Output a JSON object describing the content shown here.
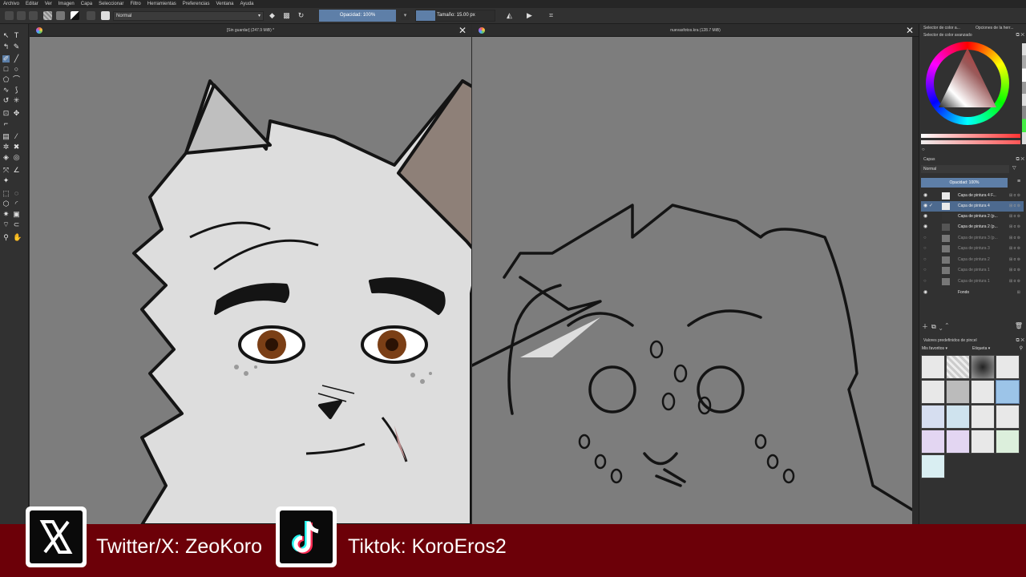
{
  "menu": [
    "Archivo",
    "Editar",
    "Ver",
    "Imagen",
    "Capa",
    "Seleccionar",
    "Filtro",
    "Herramientas",
    "Preferencias",
    "Ventana",
    "Ayuda"
  ],
  "toolbar": {
    "blend_mode": "Normal",
    "opacity_label": "Opacidad: 100%",
    "size_label": "Tamaño: 15.00 px"
  },
  "tabs": [
    {
      "title": "[Sin guardar] (247.9 MiB) *"
    },
    {
      "title": "nuevasfotos.kra (128.7 MiB)"
    }
  ],
  "docker": {
    "color_tabs": [
      "Selector de color a...",
      "Opciones de la herr..."
    ],
    "color_title": "Selector de color avanzado",
    "layers_title": "Capas",
    "layers_blend": "Normal",
    "layers_opacity": "Opacidad: 100%",
    "layers": [
      {
        "name": "Capa de pintura 4 F...",
        "visible": true,
        "selected": false
      },
      {
        "name": "Capa de pintura 4",
        "visible": true,
        "selected": true
      },
      {
        "name": "Capa de pintura 2 (p...",
        "visible": true,
        "selected": false
      },
      {
        "name": "Capa de pintura 2 (p...",
        "visible": true,
        "selected": false
      },
      {
        "name": "Capa de pintura 3 (p...",
        "visible": false,
        "selected": false
      },
      {
        "name": "Capa de pintura 3",
        "visible": false,
        "selected": false
      },
      {
        "name": "Capa de pintura 2",
        "visible": false,
        "selected": false
      },
      {
        "name": "Capa de pintura 1",
        "visible": false,
        "selected": false
      },
      {
        "name": "Capa de pintura 1",
        "visible": false,
        "selected": false
      },
      {
        "name": "Fondo",
        "visible": true,
        "selected": false
      }
    ],
    "brushes_title": "Valores predefinidos de pincel",
    "brushes_filter": "Mis favoritos",
    "brushes_tag": "Etiqueta"
  },
  "banner": {
    "twitter": "Twitter/X: ZeoKoro",
    "tiktok": "Tiktok: KoroEros2"
  },
  "colors": {
    "accent": "#5e7fa8",
    "banner": "#6c0008",
    "canvas": "#7d7d7d"
  }
}
